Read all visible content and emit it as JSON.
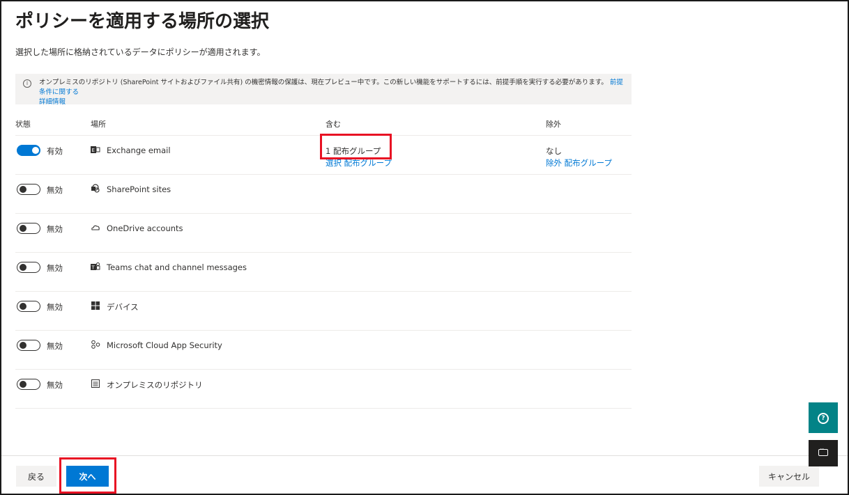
{
  "page": {
    "title": "ポリシーを適用する場所の選択",
    "subtitle": "選択した場所に格納されているデータにポリシーが適用されます。"
  },
  "banner": {
    "icon": "info-icon",
    "text": "オンプレミスのリポジトリ (SharePoint サイトおよびファイル共有) の機密情報の保護は、現在プレビュー中です。この新しい機能をサポートするには、前提手順を実行する必要があります。",
    "link_text_1": "前提条件に関する",
    "link_text_2": "詳細情報"
  },
  "table": {
    "headers": {
      "status": "状態",
      "location": "場所",
      "include": "含む",
      "exclude": "除外"
    },
    "rows": [
      {
        "on": true,
        "state": "有効",
        "icon": "exchange-icon",
        "name": "Exchange email",
        "include_value": "1 配布グループ",
        "include_link": "選択 配布グループ",
        "exclude_value": "なし",
        "exclude_link": "除外 配布グループ"
      },
      {
        "on": false,
        "state": "無効",
        "icon": "sharepoint-icon",
        "name": "SharePoint sites"
      },
      {
        "on": false,
        "state": "無効",
        "icon": "onedrive-icon",
        "name": "OneDrive accounts"
      },
      {
        "on": false,
        "state": "無効",
        "icon": "teams-icon",
        "name": "Teams chat and channel messages"
      },
      {
        "on": false,
        "state": "無効",
        "icon": "windows-icon",
        "name": "デバイス"
      },
      {
        "on": false,
        "state": "無効",
        "icon": "cloud-app-security-icon",
        "name": "Microsoft Cloud App Security"
      },
      {
        "on": false,
        "state": "無効",
        "icon": "repository-icon",
        "name": "オンプレミスのリポジトリ"
      }
    ]
  },
  "footer": {
    "back_label": "戻る",
    "next_label": "次へ",
    "cancel_label": "キャンセル"
  },
  "colors": {
    "accent": "#0078d4",
    "highlight": "#e81123",
    "help_button": "#038387"
  }
}
